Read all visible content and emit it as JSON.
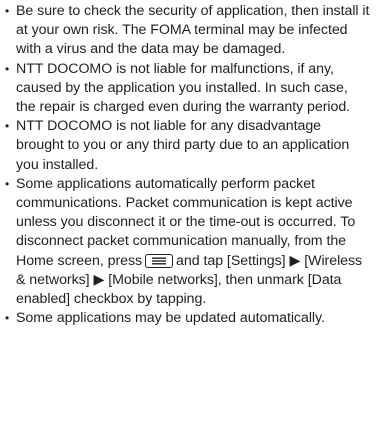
{
  "bullet_glyph": "•",
  "bullets": [
    {
      "text": "Be sure to check the security of application, then install it at your own risk. The FOMA terminal may be infected with a virus and the data may be damaged."
    },
    {
      "text": "NTT DOCOMO is not liable for malfunctions, if any, caused by the application you installed. In such case, the repair is charged even during the warranty period."
    },
    {
      "text": "NTT DOCOMO is not liable for any disadvantage brought to you or any third party due to an application you installed."
    },
    {
      "text_before_key": "Some applications automatically perform packet communications. Packet communication is kept active unless you disconnect it or the time-out is occurred. To disconnect packet communication manually, from the Home screen, press",
      "key_icon": "menu-key-icon",
      "text_after_key": "and tap [Settings] ▶ [Wireless & networks] ▶ [Mobile networks], then unmark [Data enabled] checkbox by tapping."
    },
    {
      "text": "Some applications may be updated automatically."
    }
  ]
}
